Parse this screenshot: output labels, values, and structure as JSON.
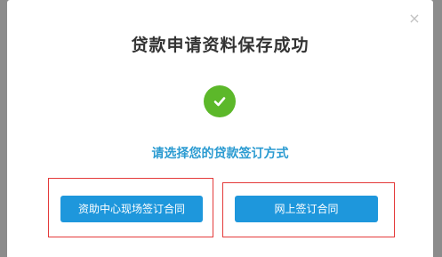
{
  "modal": {
    "close_glyph": "×",
    "title": "贷款申请资料保存成功",
    "subtitle": "请选择您的贷款签订方式",
    "status_icon": "check-icon",
    "colors": {
      "success_green": "#5cb82a",
      "accent_blue": "#2b9bd1",
      "button_blue": "#1e97dc",
      "highlight_red": "#e43a3a"
    },
    "buttons": {
      "onsite_label": "资助中心现场签订合同",
      "online_label": "网上签订合同"
    }
  }
}
